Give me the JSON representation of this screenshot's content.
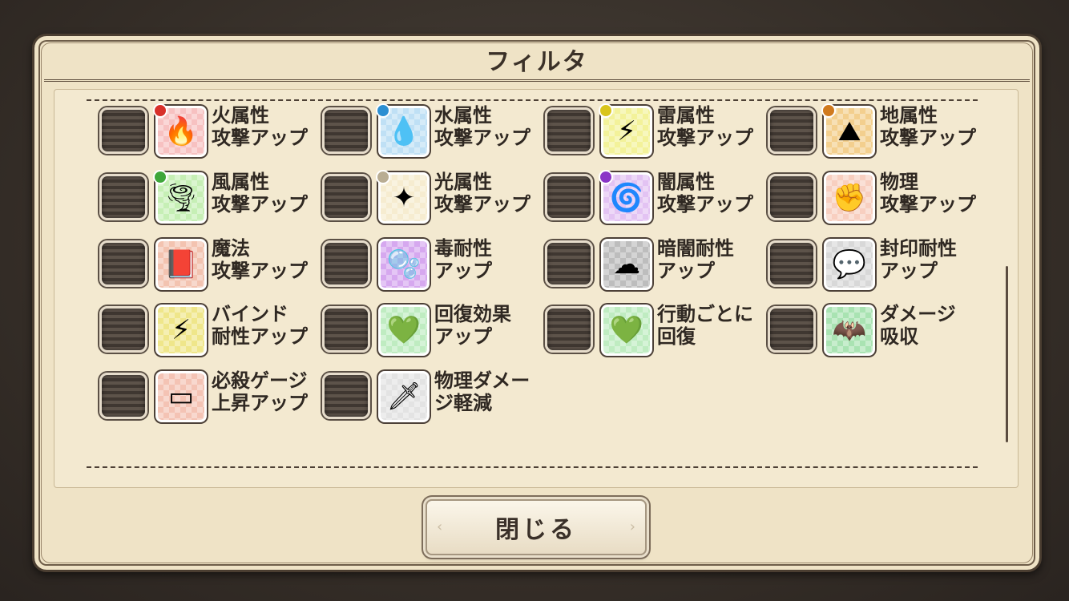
{
  "dialog": {
    "title": "フィルタ",
    "close_label": "閉じる"
  },
  "filters": [
    {
      "label": "火属性\n攻撃アップ",
      "icon": "fire-icon",
      "glyph": "🔥",
      "bg": "#f7c1c1",
      "badge": "#d8302a"
    },
    {
      "label": "水属性\n攻撃アップ",
      "icon": "water-drop-icon",
      "glyph": "💧",
      "bg": "#bfe0f5",
      "badge": "#2c8fd2"
    },
    {
      "label": "雷属性\n攻撃アップ",
      "icon": "lightning-icon",
      "glyph": "⚡",
      "bg": "#f3f29a",
      "badge": "#d9c51b"
    },
    {
      "label": "地属性\n攻撃アップ",
      "icon": "earth-rock-icon",
      "glyph": "⛰",
      "bg": "#f3cf8e",
      "badge": "#d07a1e"
    },
    {
      "label": "風属性\n攻撃アップ",
      "icon": "tornado-icon",
      "glyph": "🌪",
      "bg": "#c6efb5",
      "badge": "#3ea63a"
    },
    {
      "label": "光属性\n攻撃アップ",
      "icon": "light-compass-icon",
      "glyph": "✦",
      "bg": "#f6ecd0",
      "badge": "#b9ad93"
    },
    {
      "label": "闇属性\n攻撃アップ",
      "icon": "dark-vortex-icon",
      "glyph": "🌀",
      "bg": "#e3c3f3",
      "badge": "#8a35c7"
    },
    {
      "label": "物理\n攻撃アップ",
      "icon": "fist-icon",
      "glyph": "✊",
      "bg": "#f8cfc0",
      "badge": ""
    },
    {
      "label": "魔法\n攻撃アップ",
      "icon": "spellbook-icon",
      "glyph": "📕",
      "bg": "#f3c3b0",
      "badge": ""
    },
    {
      "label": "毒耐性\nアップ",
      "icon": "poison-bubble-icon",
      "glyph": "🫧",
      "bg": "#d6a8ef",
      "badge": ""
    },
    {
      "label": "暗闇耐性\nアップ",
      "icon": "darkness-cloud-icon",
      "glyph": "☁",
      "bg": "#bdbdbd",
      "badge": ""
    },
    {
      "label": "封印耐性\nアップ",
      "icon": "speech-seal-icon",
      "glyph": "💬",
      "bg": "#d8d8d8",
      "badge": ""
    },
    {
      "label": "バインド\n耐性アップ",
      "icon": "bind-lightning-icon",
      "glyph": "⚡",
      "bg": "#efe68a",
      "badge": ""
    },
    {
      "label": "回復効果\nアップ",
      "icon": "heal-heart-icon",
      "glyph": "💚",
      "bg": "#bfecc1",
      "badge": ""
    },
    {
      "label": "行動ごとに\n回復",
      "icon": "regen-heart-icon",
      "glyph": "💚",
      "bg": "#bfecc1",
      "badge": ""
    },
    {
      "label": "ダメージ\n吸収",
      "icon": "bat-drain-icon",
      "glyph": "🦇",
      "bg": "#a9e3b2",
      "badge": ""
    },
    {
      "label": "必殺ゲージ\n上昇アップ",
      "icon": "gauge-up-icon",
      "glyph": "▭",
      "bg": "#f4c3b4",
      "badge": ""
    },
    {
      "label": "物理ダメー\nジ軽減",
      "icon": "sword-guard-icon",
      "glyph": "🗡",
      "bg": "#e3e3e3",
      "badge": ""
    }
  ]
}
